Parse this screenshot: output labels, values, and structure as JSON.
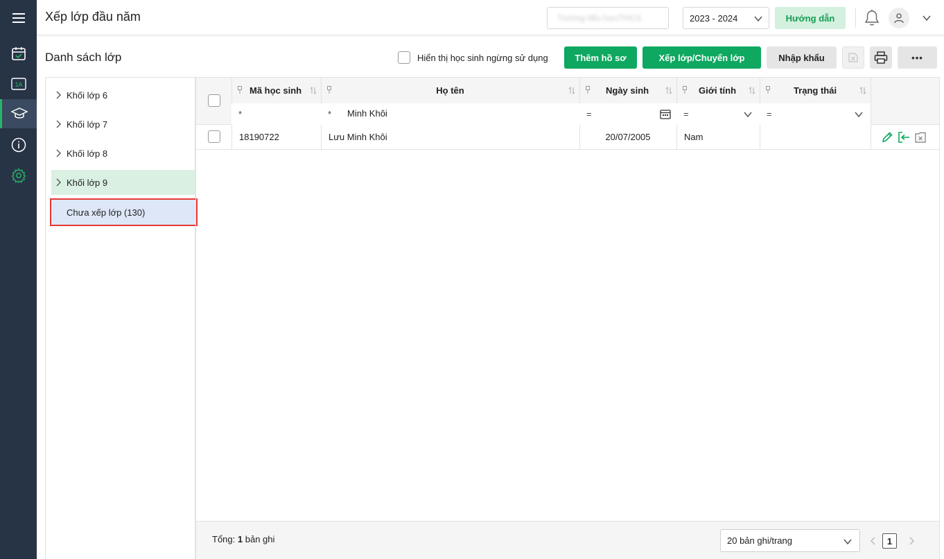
{
  "header": {
    "title": "Xếp lớp đầu năm",
    "school_placeholder": "Trường tiểu học/THCS",
    "year": "2023 - 2024",
    "guide_label": "Hướng dẫn"
  },
  "rail": {
    "items": [
      {
        "name": "menu-icon"
      },
      {
        "name": "calendar-icon"
      },
      {
        "name": "class-1a-icon",
        "text": "1A"
      },
      {
        "name": "graduation-cap-icon",
        "active": true
      },
      {
        "name": "info-icon"
      },
      {
        "name": "settings-icon"
      }
    ]
  },
  "toolbar": {
    "section_title": "Danh sách lớp",
    "show_inactive_label": "Hiển thị học sinh ngừng sử dụng",
    "add_label": "Thêm hồ sơ",
    "assign_label": "Xếp lớp/Chuyển lớp",
    "import_label": "Nhập khẩu",
    "more_label": "•••"
  },
  "tree": {
    "items": [
      {
        "label": "Khối lớp 6"
      },
      {
        "label": "Khối lớp 7"
      },
      {
        "label": "Khối lớp 8"
      },
      {
        "label": "Khối lớp 9"
      },
      {
        "label": "Chưa xếp lớp (130)"
      }
    ]
  },
  "grid": {
    "columns": [
      {
        "label": "Mã học sinh"
      },
      {
        "label": "Họ tên"
      },
      {
        "label": "Ngày sinh"
      },
      {
        "label": "Giới tính"
      },
      {
        "label": "Trạng thái"
      }
    ],
    "filters": {
      "code_op": "*",
      "code_value": "",
      "name_op": "*",
      "name_value": "Minh Khôi",
      "dob_op": "=",
      "gender_op": "=",
      "status_op": "="
    },
    "rows": [
      {
        "code": "18190722",
        "name": "Lưu Minh Khôi",
        "dob": "20/07/2005",
        "gender": "Nam",
        "status": ""
      }
    ],
    "footer": {
      "total_prefix": "Tổng:",
      "total_count": "1",
      "total_suffix": "bản ghi",
      "page_size": "20 bản ghi/trang",
      "current_page": "1"
    }
  },
  "colors": {
    "rail_bg": "#273446",
    "accent_green": "#0ea860",
    "selected_tree": "#d9f0e3",
    "highlight_tree": "#dde7f8",
    "highlight_border": "#e53935"
  }
}
